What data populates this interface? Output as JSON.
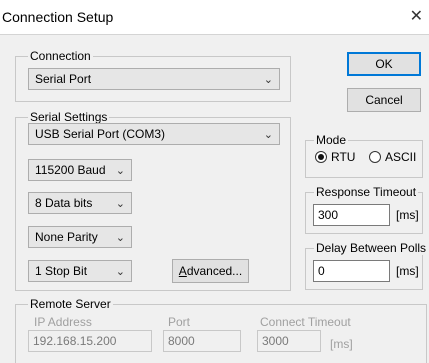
{
  "window": {
    "title": "Connection Setup",
    "close_symbol": "✕"
  },
  "connection": {
    "legend": "Connection",
    "type": "Serial Port"
  },
  "buttons": {
    "ok": "OK",
    "cancel": "Cancel",
    "advanced": "Advanced...",
    "advanced_mnemonic": "A",
    "advanced_rest": "dvanced..."
  },
  "serial": {
    "legend": "Serial Settings",
    "port": "USB Serial Port (COM3)",
    "baud": "115200 Baud",
    "data_bits": "8 Data bits",
    "parity": "None Parity",
    "stop_bits": "1 Stop Bit"
  },
  "mode": {
    "legend": "Mode",
    "options": [
      "RTU",
      "ASCII"
    ],
    "selected": "RTU"
  },
  "response_timeout": {
    "legend": "Response Timeout",
    "value": "300",
    "unit": "[ms]"
  },
  "delay_between_polls": {
    "legend": "Delay Between Polls",
    "value": "0",
    "unit": "[ms]"
  },
  "remote_server": {
    "legend": "Remote Server",
    "ip_label": "IP Address",
    "ip_value": "192.168.15.200",
    "port_label": "Port",
    "port_value": "8000",
    "timeout_label": "Connect Timeout",
    "timeout_value": "3000",
    "timeout_unit": "[ms]"
  },
  "icons": {
    "dropdown": "chevron-down-icon",
    "close": "close-icon"
  }
}
